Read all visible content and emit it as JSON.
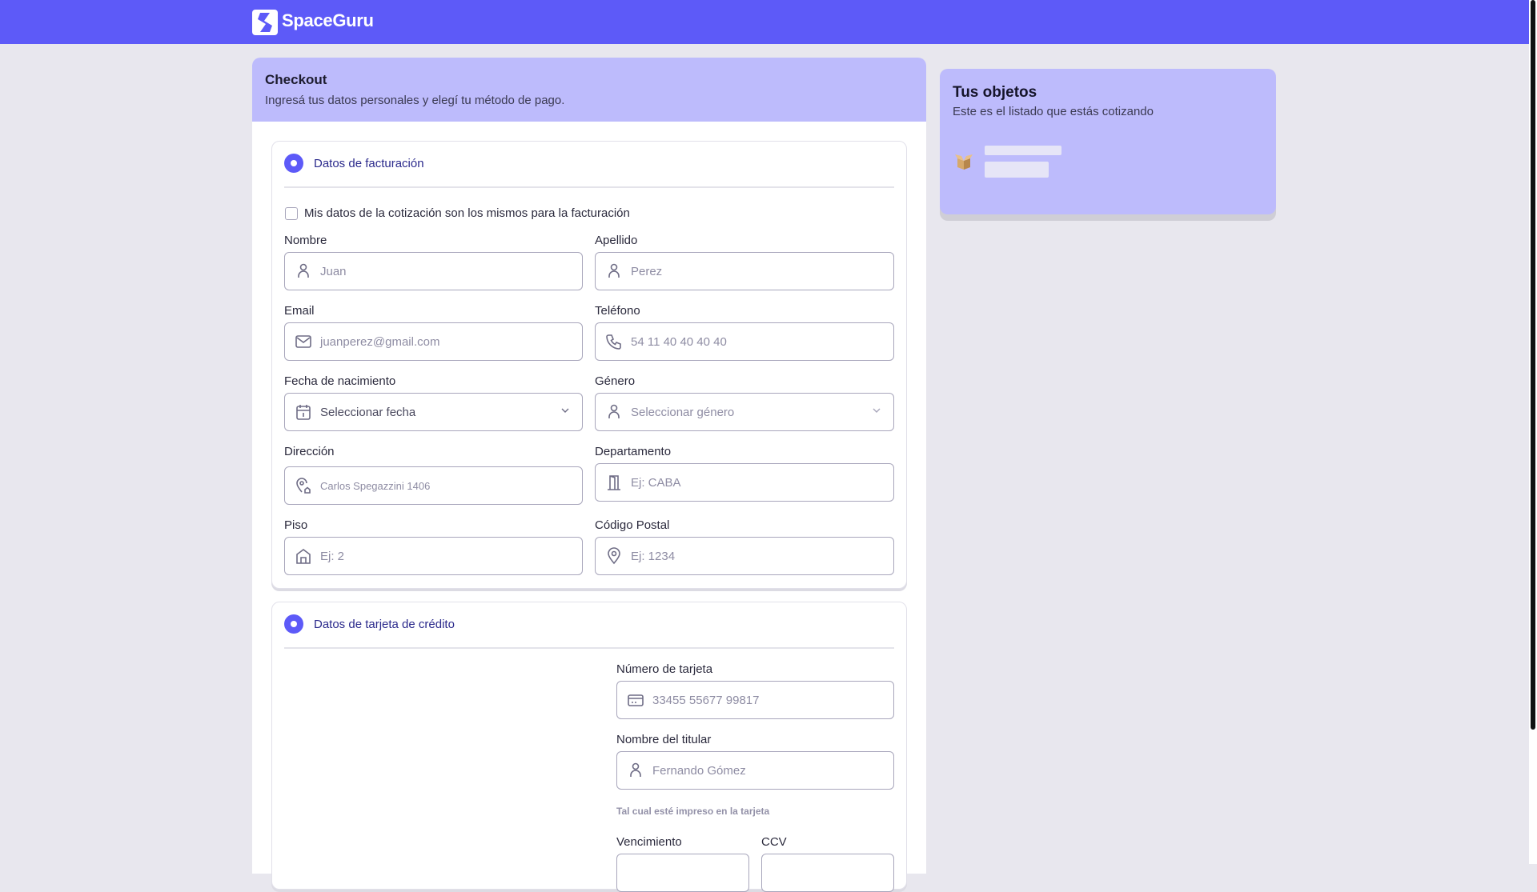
{
  "header": {
    "brand": "SpaceGuru"
  },
  "checkout": {
    "title": "Checkout",
    "subtitle": "Ingresá tus datos personales y elegí tu método de pago."
  },
  "billing": {
    "title": "Datos de facturación",
    "same_data_label": "Mis datos de la cotización son los mismos para la facturación",
    "fields": {
      "nombre": {
        "label": "Nombre",
        "placeholder": "Juan"
      },
      "apellido": {
        "label": "Apellido",
        "placeholder": "Perez"
      },
      "email": {
        "label": "Email",
        "placeholder": "juanperez@gmail.com"
      },
      "telefono": {
        "label": "Teléfono",
        "placeholder": "54 11 40 40 40 40"
      },
      "fecha": {
        "label": "Fecha de nacimiento",
        "placeholder": "Seleccionar fecha"
      },
      "genero": {
        "label": "Género",
        "placeholder": "Seleccionar género"
      },
      "direccion": {
        "label": "Dirección",
        "placeholder": "Carlos Spegazzini 1406"
      },
      "departamento": {
        "label": "Departamento",
        "placeholder": "Ej: CABA"
      },
      "piso": {
        "label": "Piso",
        "placeholder": "Ej: 2"
      },
      "cp": {
        "label": "Código Postal",
        "placeholder": "Ej: 1234"
      }
    }
  },
  "card": {
    "title": "Datos de tarjeta de crédito",
    "numero": {
      "label": "Número de tarjeta",
      "placeholder": "33455 55677 99817"
    },
    "titular": {
      "label": "Nombre del titular",
      "placeholder": "Fernando Gómez",
      "hint": "Tal cual esté impreso en la tarjeta"
    },
    "vencimiento": {
      "label": "Vencimiento"
    },
    "ccv": {
      "label": "CCV"
    }
  },
  "cart": {
    "title": "Tus objetos",
    "subtitle": "Este es el listado que estás cotizando"
  }
}
